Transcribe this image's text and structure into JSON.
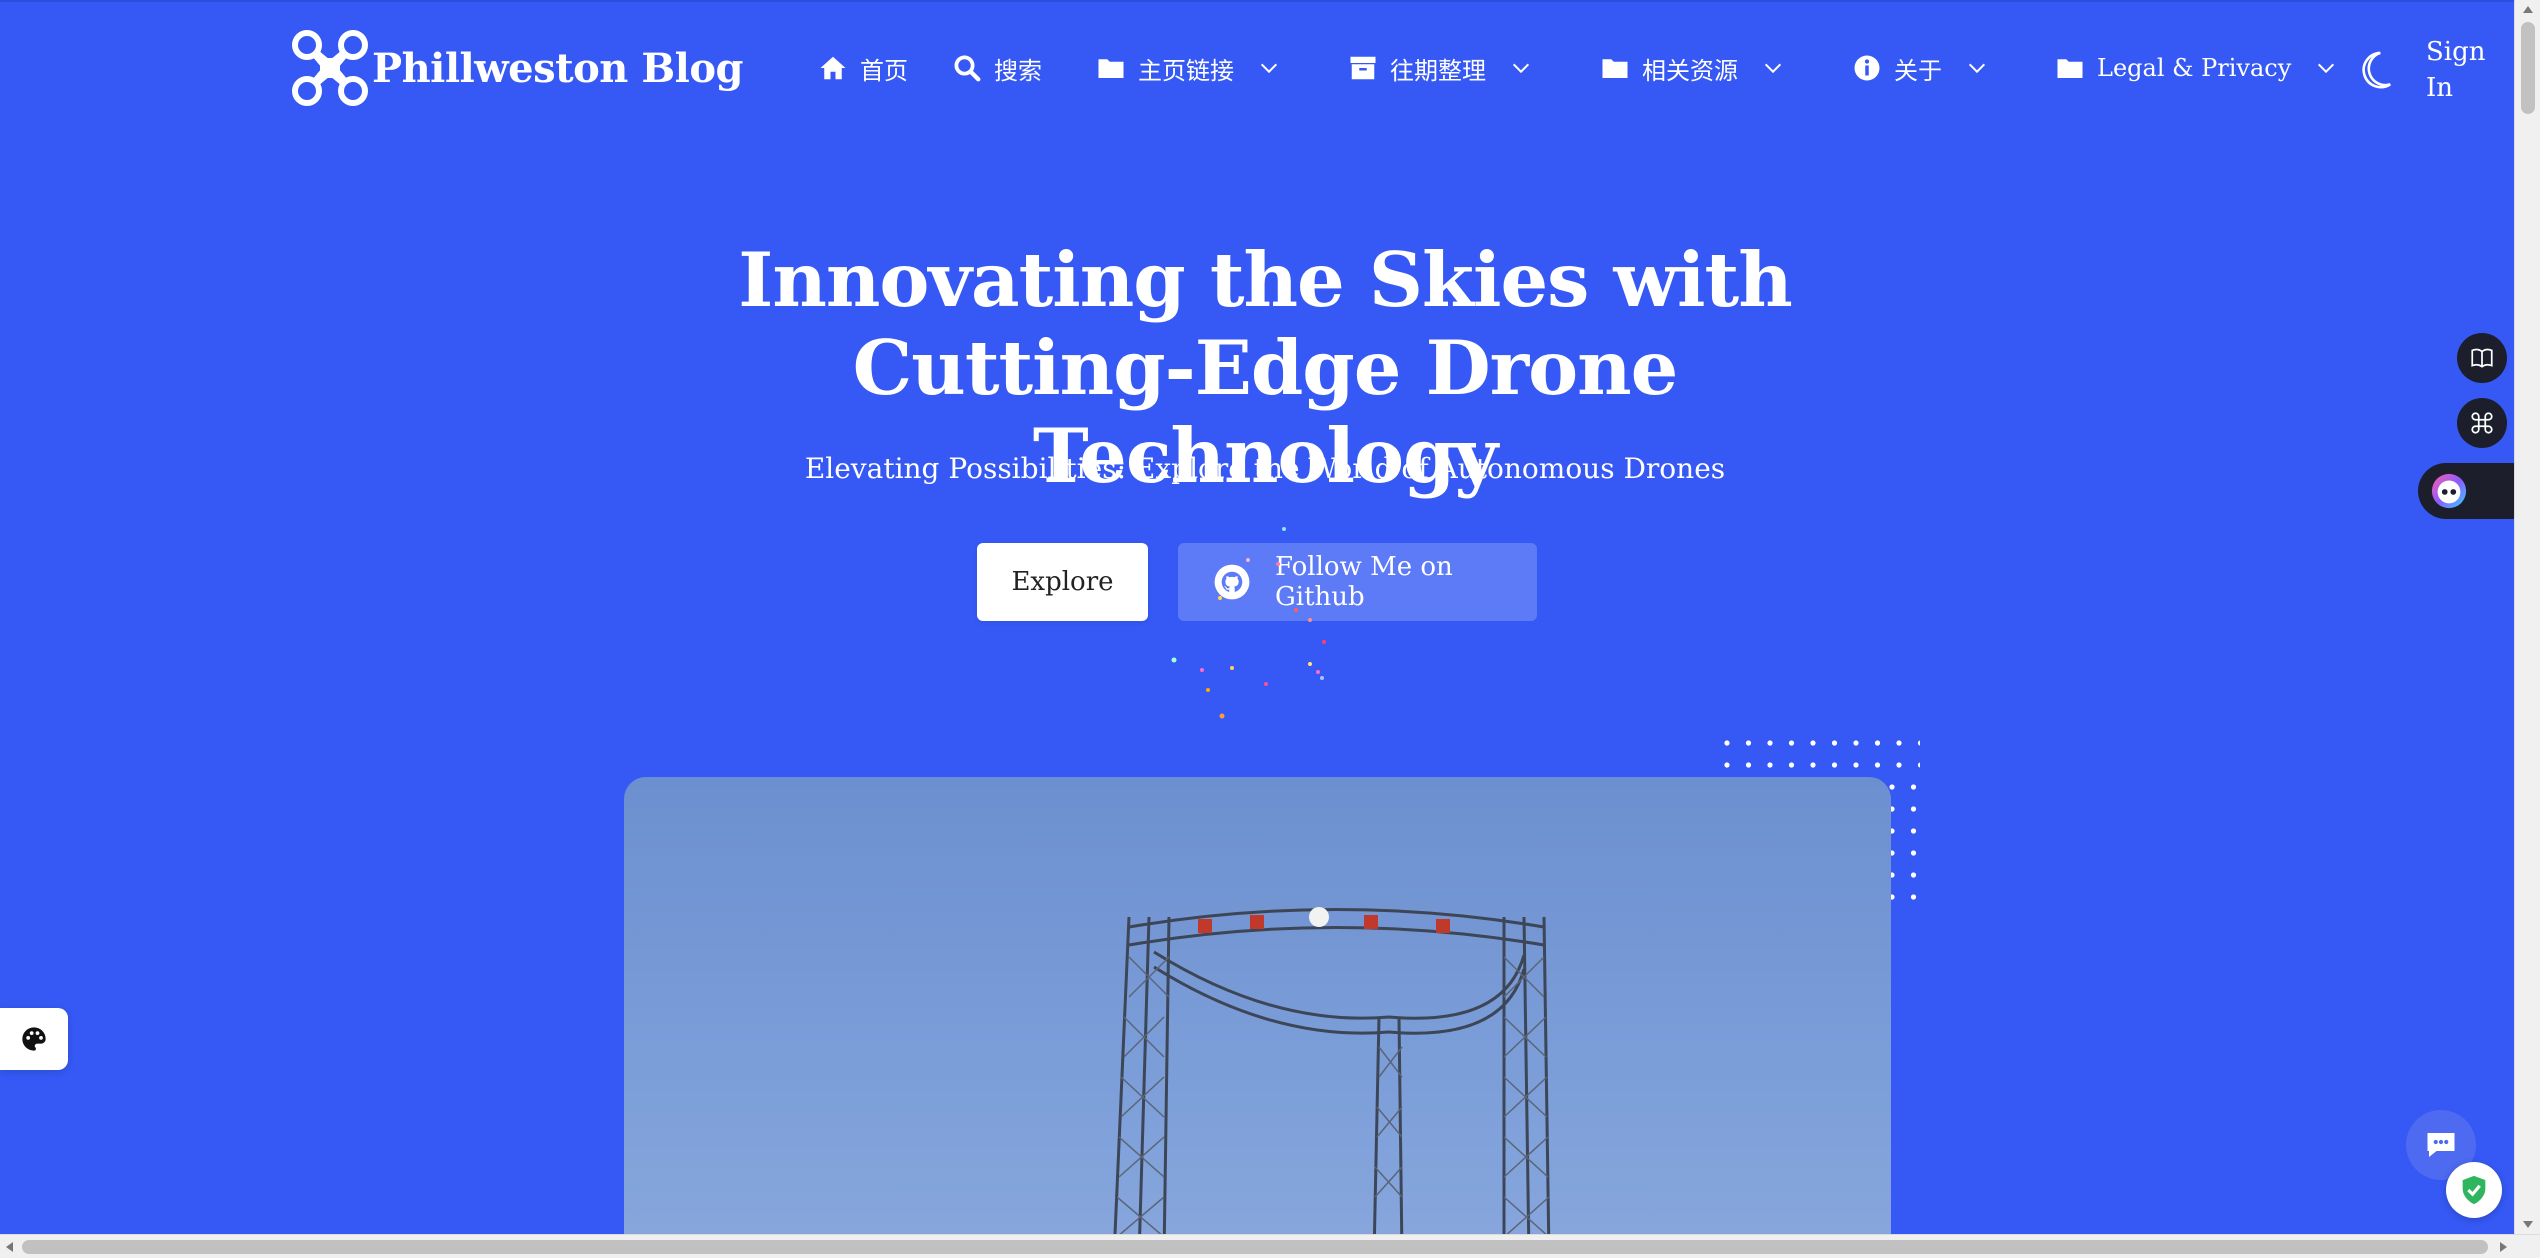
{
  "header": {
    "logo_text": "Phillweston Blog",
    "nav": [
      {
        "label": "首页",
        "icon": "home-icon",
        "dropdown": false
      },
      {
        "label": "搜索",
        "icon": "search-icon",
        "dropdown": false
      },
      {
        "label": "主页链接",
        "icon": "folder-icon",
        "dropdown": true
      },
      {
        "label": "往期整理",
        "icon": "archive-icon",
        "dropdown": true
      },
      {
        "label": "相关资源",
        "icon": "folder-icon",
        "dropdown": true
      },
      {
        "label": "关于",
        "icon": "info-icon",
        "dropdown": true
      },
      {
        "label": "Legal & Privacy",
        "icon": "folder-icon",
        "dropdown": true
      }
    ],
    "theme_toggle_icon": "moon-icon",
    "signin_label": "Sign In"
  },
  "hero": {
    "title": "Innovating the Skies with Cutting-Edge Drone Technology",
    "subtitle": "Elevating Possibilities: Explore the World of Autonomous Drones",
    "explore_label": "Explore",
    "github_label": "Follow Me on Github",
    "github_icon": "github-icon"
  },
  "side_widgets": {
    "book_icon": "book-icon",
    "command_icon": "command-icon",
    "assistant_icon": "robot-avatar-icon",
    "palette_icon": "palette-icon",
    "chat_icon": "chat-icon",
    "shield_icon": "shield-check-icon"
  },
  "colors": {
    "background": "#3659f5",
    "button_secondary": "#5d7af7",
    "widget_dark": "#1c1f2b"
  }
}
